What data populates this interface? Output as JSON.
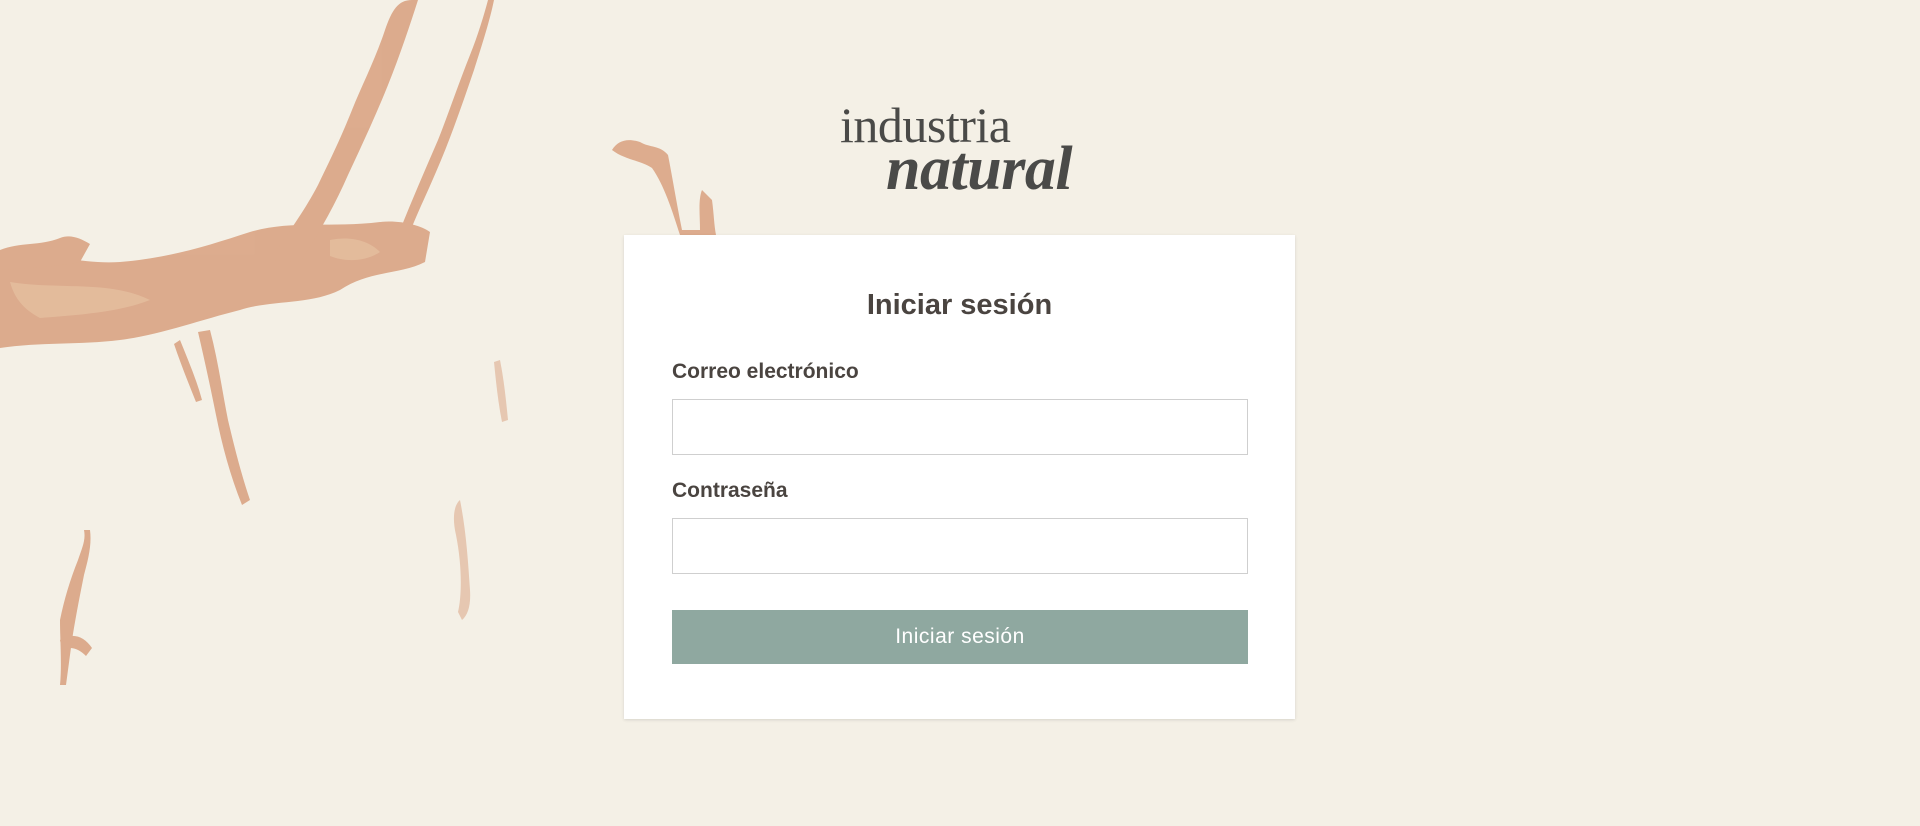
{
  "logo": {
    "line1": "industria",
    "line2": "natural"
  },
  "login": {
    "title": "Iniciar sesión",
    "email_label": "Correo electrónico",
    "email_value": "",
    "password_label": "Contraseña",
    "password_value": "",
    "submit_label": "Iniciar sesión"
  },
  "colors": {
    "background": "#f4f0e6",
    "card": "#ffffff",
    "text": "#4a4440",
    "button": "#8fa8a0",
    "marble_vein": "#d9a27f"
  }
}
